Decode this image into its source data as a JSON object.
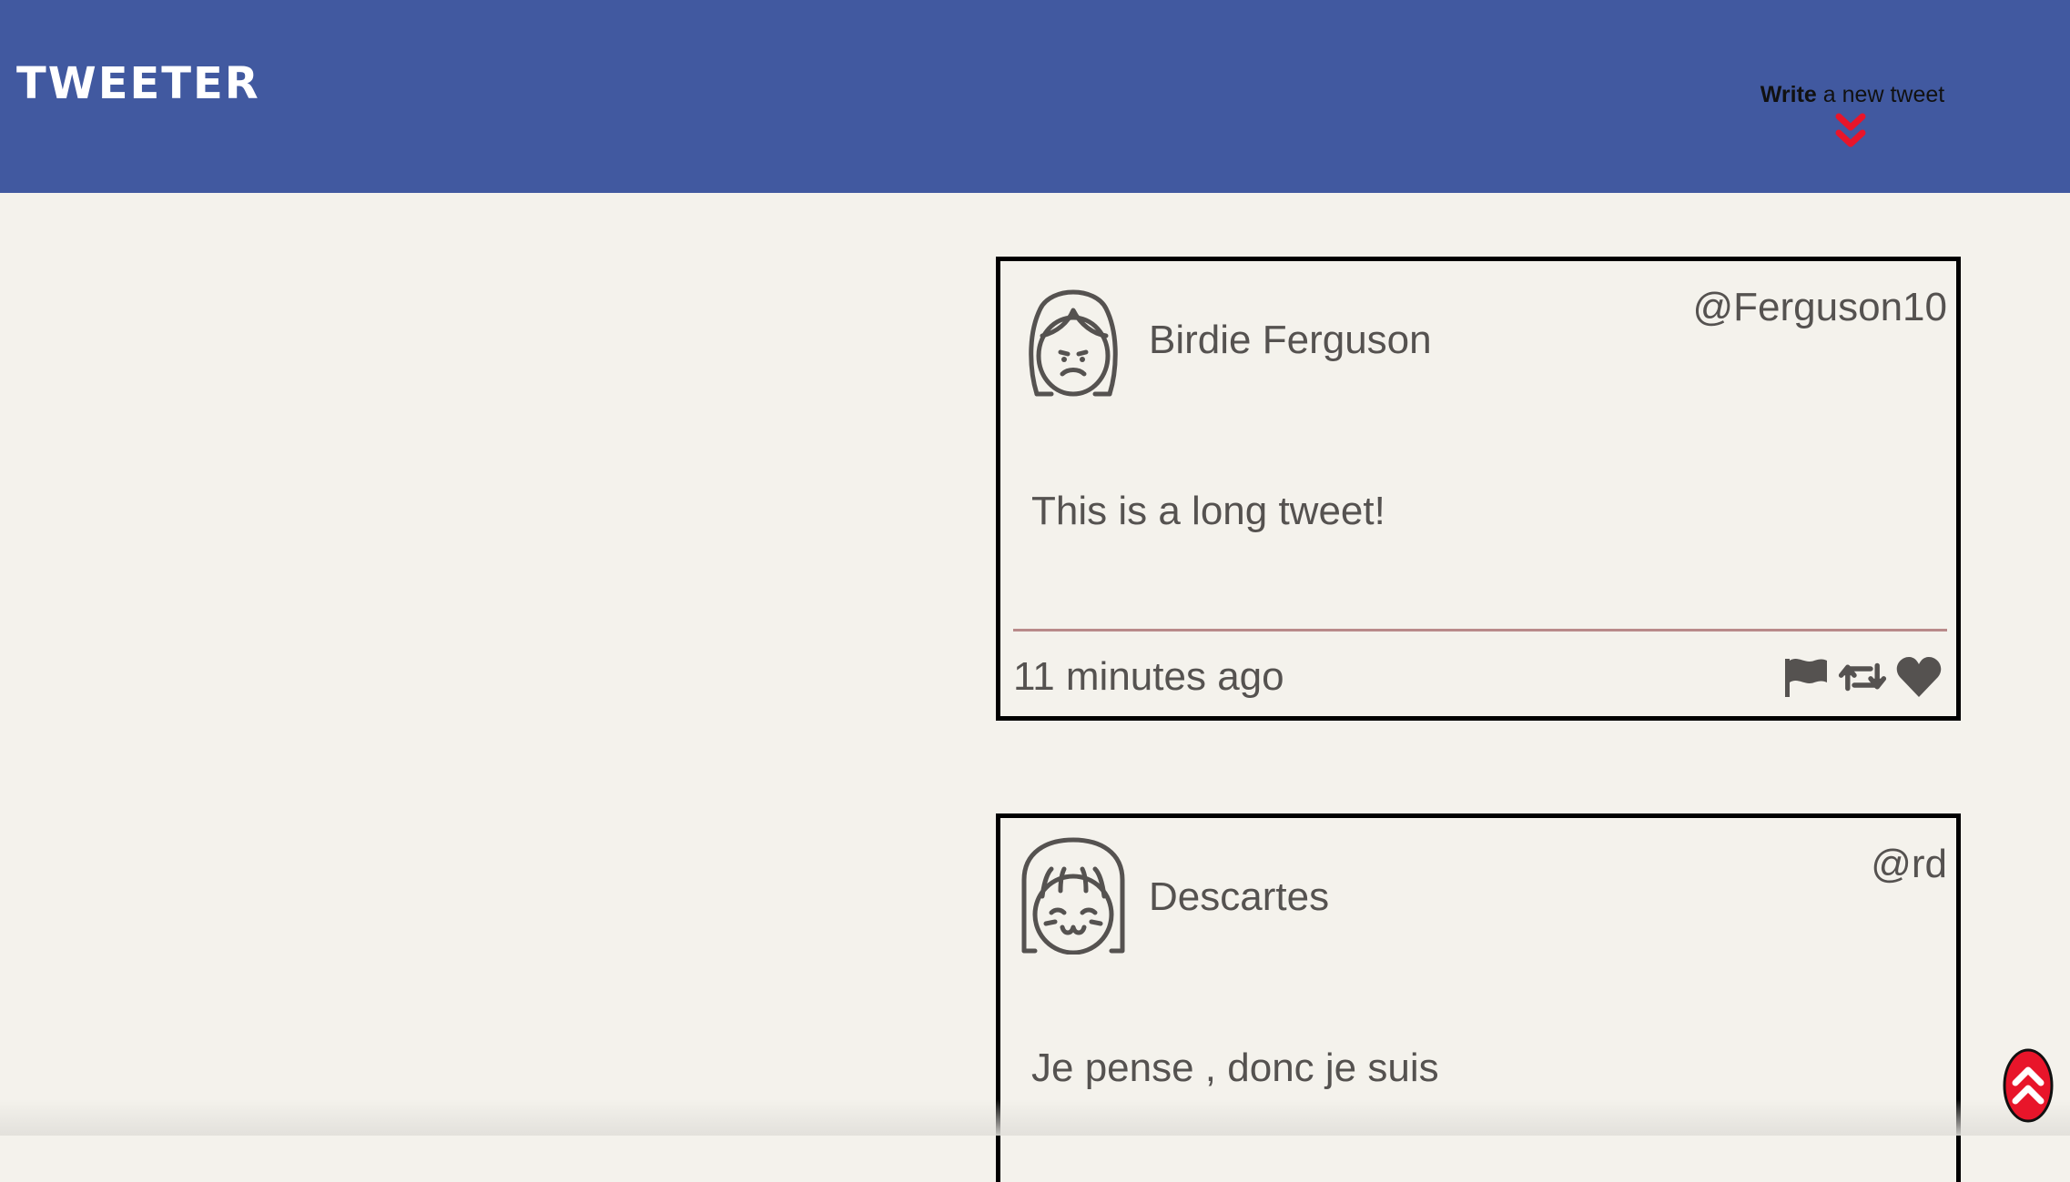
{
  "nav": {
    "brand": "TWEETER",
    "compose_bold": "Write",
    "compose_rest": " a new tweet",
    "compose_icon": "double-chevron-down-icon"
  },
  "colors": {
    "nav_background": "#4159a0",
    "page_background": "#f4f2ec",
    "accent_red": "#e8152a",
    "text_gray": "#555250",
    "divider": "#b98a8a"
  },
  "tweets": [
    {
      "name": "Birdie Ferguson",
      "handle": "@Ferguson10",
      "content": "This is a long tweet!",
      "timestamp": "11 minutes ago",
      "avatar_icon": "sad-girl-face-icon",
      "actions": [
        "flag-icon",
        "retweet-icon",
        "heart-icon"
      ]
    },
    {
      "name": "Descartes",
      "handle": "@rd",
      "content": "Je pense , donc je suis",
      "avatar_icon": "smiling-girl-face-icon"
    }
  ],
  "scroll_top_icon": "double-chevron-up-icon"
}
